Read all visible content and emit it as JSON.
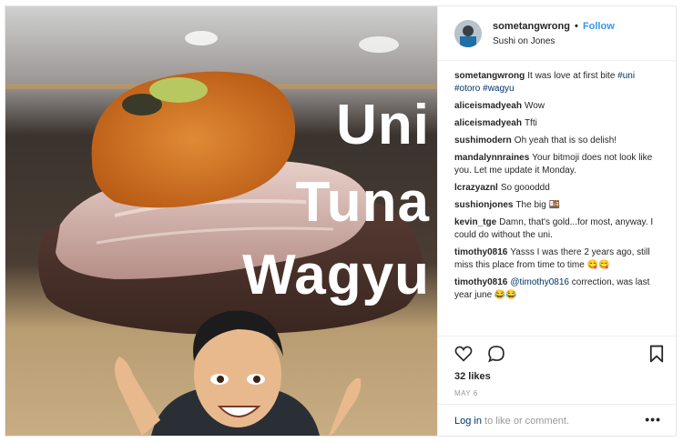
{
  "post": {
    "username": "sometangwrong",
    "separator": "•",
    "follow_label": "Follow",
    "location": "Sushi on Jones",
    "photo_text": [
      "Uni",
      "Tuna",
      "Wagyu"
    ],
    "comments": [
      {
        "user": "sometangwrong",
        "text": "It was love at first bite ",
        "tags": [
          "#uni",
          "#otoro",
          "#wagyu"
        ]
      },
      {
        "user": "aliceismadyeah",
        "text": "Wow"
      },
      {
        "user": "aliceismadyeah",
        "text": "Tfti"
      },
      {
        "user": "sushimodern",
        "text": "Oh yeah that is so delish!"
      },
      {
        "user": "mandalynnraines",
        "text": "Your bitmoji does not look like you. Let me update it Monday."
      },
      {
        "user": "lcrazyaznl",
        "text": "So goooddd"
      },
      {
        "user": "sushionjones",
        "text": "The big 🍱"
      },
      {
        "user": "kevin_tge",
        "text": "Damn, that's gold...for most, anyway. I could do without the uni."
      },
      {
        "user": "timothy0816",
        "text": "Yasss I was there 2 years ago, still miss this place from time to time 😋😋"
      },
      {
        "user": "timothy0816",
        "text": " correction, was last year june 😂😂",
        "mention": "@timothy0816"
      }
    ],
    "likes": "32 likes",
    "date": "MAY 6",
    "login_link": "Log in",
    "login_rest": " to like or comment.",
    "more_label": "•••"
  },
  "icons": {
    "like": "heart-icon",
    "comment": "comment-bubble-icon",
    "save": "bookmark-icon",
    "more": "more-options-icon"
  },
  "colors": {
    "link": "#3897f0",
    "tag": "#003569",
    "muted": "#999999"
  }
}
